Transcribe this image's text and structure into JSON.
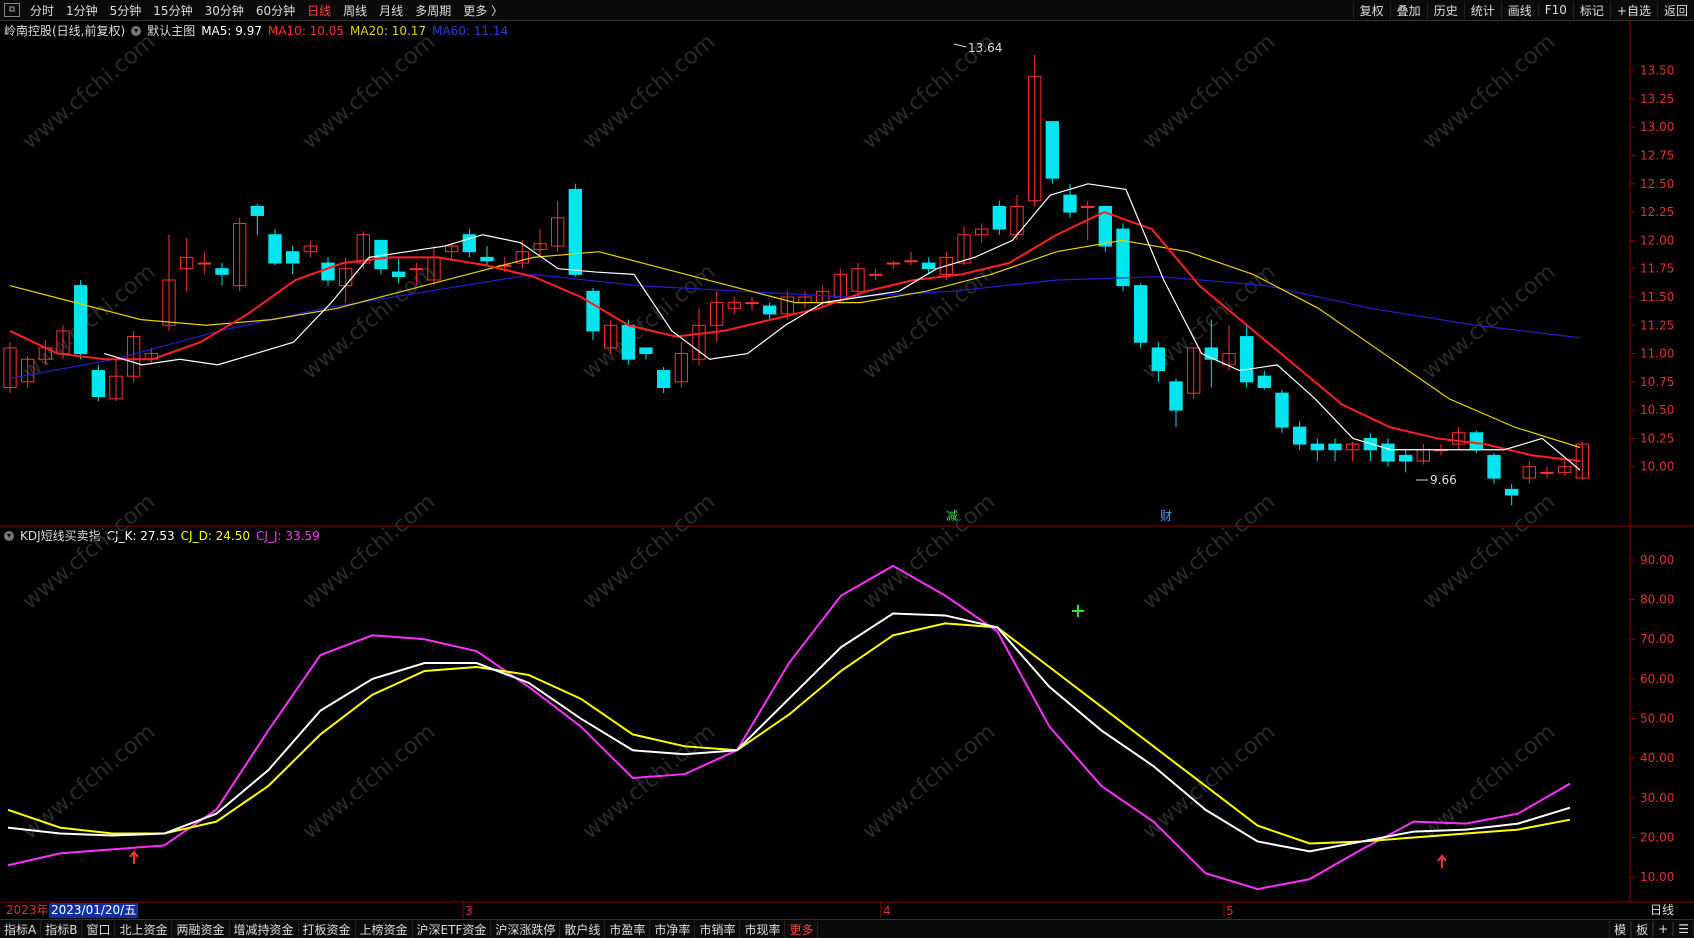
{
  "toolbar": {
    "periods": [
      "分时",
      "1分钟",
      "5分钟",
      "15分钟",
      "30分钟",
      "60分钟",
      "日线",
      "周线",
      "月线",
      "多周期",
      "更多 〉"
    ],
    "active_period": "日线",
    "right": [
      "复权",
      "叠加",
      "历史",
      "统计",
      "画线",
      "F10",
      "标记",
      "+自选",
      "返回"
    ]
  },
  "main": {
    "stock_title": "岭南控股(日线,前复权)",
    "template": "默认主图",
    "ma5": "MA5: 9.97",
    "ma10": "MA10: 10.05",
    "ma20": "MA20: 10.17",
    "ma60": "MA60: 11.14",
    "high_label": "13.64",
    "low_label": "9.66",
    "markers": [
      "减",
      "财"
    ],
    "y_ticks": [
      "13.50",
      "13.25",
      "13.00",
      "12.75",
      "12.50",
      "12.25",
      "12.00",
      "11.75",
      "11.50",
      "11.25",
      "11.00",
      "10.75",
      "10.50",
      "10.25",
      "10.00"
    ]
  },
  "kdj": {
    "name": "KDJ短线买卖指",
    "k": "CJ_K: 27.53",
    "d": "CJ_D: 24.50",
    "j": "CJ_J: 33.59",
    "y_ticks": [
      "90.00",
      "80.00",
      "70.00",
      "60.00",
      "50.00",
      "40.00",
      "30.00",
      "20.00",
      "10.00"
    ]
  },
  "timeline": {
    "year": "2023年",
    "cursor_date": "2023/01/20/五",
    "months": [
      "3",
      "4",
      "5"
    ],
    "period": "日线"
  },
  "bottom_tabs": [
    "指标A",
    "指标B",
    "窗口",
    "北上资金",
    "两融资金",
    "增减持资金",
    "打板资金",
    "上榜资金",
    "沪深ETF资金",
    "沪深涨跌停",
    "散户线",
    "市盈率",
    "市净率",
    "市销率",
    "市现率",
    "更多"
  ],
  "bottom_right": [
    "模",
    "板",
    "+",
    "☰"
  ],
  "watermark": "www.cfchi.com",
  "colors": {
    "up": "#ff3030",
    "down": "#00e5ee",
    "ma5": "#ffffff",
    "ma10": "#ff2020",
    "ma20": "#e8d000",
    "ma60": "#2020d0",
    "k": "#ffffff",
    "d": "#ffff00",
    "j": "#ff30ff",
    "grid": "#8b0000"
  },
  "chart_data": [
    {
      "type": "candlestick",
      "title": "岭南控股(日线,前复权)",
      "ylim": [
        9.6,
        13.7
      ],
      "candles": [
        [
          10.7,
          11.05,
          11.1,
          10.65
        ],
        [
          10.75,
          10.95,
          10.98,
          10.7
        ],
        [
          10.95,
          11.05,
          11.12,
          10.9
        ],
        [
          11.0,
          11.2,
          11.25,
          10.95
        ],
        [
          11.6,
          11.0,
          11.65,
          10.95
        ],
        [
          10.85,
          10.62,
          10.9,
          10.58
        ],
        [
          10.6,
          10.8,
          10.95,
          10.58
        ],
        [
          10.8,
          11.15,
          11.2,
          10.75
        ],
        [
          10.95,
          11.0,
          11.05,
          10.9
        ],
        [
          11.25,
          11.65,
          12.05,
          11.2
        ],
        [
          11.75,
          11.85,
          12.02,
          11.55
        ],
        [
          11.8,
          11.8,
          11.9,
          11.7
        ],
        [
          11.75,
          11.7,
          11.8,
          11.6
        ],
        [
          11.6,
          12.15,
          12.2,
          11.55
        ],
        [
          12.3,
          12.22,
          12.32,
          12.05
        ],
        [
          12.05,
          11.8,
          12.1,
          11.78
        ],
        [
          11.9,
          11.8,
          11.95,
          11.7
        ],
        [
          11.9,
          11.95,
          12.0,
          11.85
        ],
        [
          11.8,
          11.65,
          11.85,
          11.6
        ],
        [
          11.6,
          11.75,
          11.85,
          11.45
        ],
        [
          11.8,
          12.05,
          12.08,
          11.75
        ],
        [
          12.0,
          11.75,
          12.0,
          11.7
        ],
        [
          11.72,
          11.68,
          11.85,
          11.62
        ],
        [
          11.75,
          11.75,
          11.8,
          11.6
        ],
        [
          11.65,
          11.85,
          11.95,
          11.6
        ],
        [
          11.9,
          11.95,
          11.98,
          11.82
        ],
        [
          12.05,
          11.9,
          12.1,
          11.85
        ],
        [
          11.85,
          11.82,
          11.95,
          11.78
        ],
        [
          11.78,
          11.78,
          11.85,
          11.72
        ],
        [
          11.8,
          11.9,
          12.0,
          11.75
        ],
        [
          11.92,
          11.97,
          12.1,
          11.85
        ],
        [
          11.95,
          12.2,
          12.35,
          11.9
        ],
        [
          12.45,
          11.7,
          12.5,
          11.68
        ],
        [
          11.55,
          11.2,
          11.58,
          11.12
        ],
        [
          11.05,
          11.25,
          11.3,
          11.0
        ],
        [
          11.25,
          10.95,
          11.3,
          10.9
        ],
        [
          11.05,
          11.0,
          11.05,
          10.95
        ],
        [
          10.85,
          10.7,
          10.88,
          10.65
        ],
        [
          10.75,
          11.0,
          11.1,
          10.7
        ],
        [
          10.95,
          11.25,
          11.4,
          10.9
        ],
        [
          11.25,
          11.45,
          11.55,
          11.1
        ],
        [
          11.4,
          11.45,
          11.5,
          11.35
        ],
        [
          11.45,
          11.45,
          11.5,
          11.38
        ],
        [
          11.42,
          11.35,
          11.45,
          11.3
        ],
        [
          11.35,
          11.5,
          11.55,
          11.3
        ],
        [
          11.45,
          11.5,
          11.55,
          11.4
        ],
        [
          11.45,
          11.55,
          11.6,
          11.4
        ],
        [
          11.5,
          11.7,
          11.75,
          11.45
        ],
        [
          11.55,
          11.75,
          11.8,
          11.5
        ],
        [
          11.7,
          11.7,
          11.75,
          11.65
        ],
        [
          11.8,
          11.8,
          11.82,
          11.75
        ],
        [
          11.82,
          11.82,
          11.9,
          11.78
        ],
        [
          11.8,
          11.75,
          11.85,
          11.7
        ],
        [
          11.7,
          11.85,
          11.9,
          11.65
        ],
        [
          11.8,
          12.05,
          12.12,
          11.78
        ],
        [
          12.05,
          12.1,
          12.15,
          11.98
        ],
        [
          12.3,
          12.1,
          12.35,
          12.05
        ],
        [
          12.05,
          12.3,
          12.4,
          12.0
        ],
        [
          12.35,
          13.45,
          13.64,
          12.3
        ],
        [
          13.05,
          12.55,
          13.05,
          12.5
        ],
        [
          12.4,
          12.25,
          12.5,
          12.2
        ],
        [
          12.3,
          12.3,
          12.35,
          12.0
        ],
        [
          12.3,
          11.95,
          12.3,
          11.9
        ],
        [
          12.1,
          11.6,
          12.15,
          11.55
        ],
        [
          11.6,
          11.1,
          11.62,
          11.05
        ],
        [
          11.05,
          10.85,
          11.1,
          10.75
        ],
        [
          10.75,
          10.5,
          10.78,
          10.35
        ],
        [
          10.65,
          11.05,
          11.05,
          10.6
        ],
        [
          11.05,
          10.95,
          11.3,
          10.7
        ],
        [
          10.9,
          11.0,
          11.25,
          10.85
        ],
        [
          11.15,
          10.75,
          11.25,
          10.7
        ],
        [
          10.8,
          10.7,
          10.85,
          10.68
        ],
        [
          10.65,
          10.35,
          10.68,
          10.3
        ],
        [
          10.35,
          10.2,
          10.4,
          10.15
        ],
        [
          10.2,
          10.15,
          10.25,
          10.05
        ],
        [
          10.2,
          10.15,
          10.25,
          10.05
        ],
        [
          10.15,
          10.2,
          10.22,
          10.05
        ],
        [
          10.25,
          10.15,
          10.3,
          10.05
        ],
        [
          10.2,
          10.05,
          10.25,
          10.0
        ],
        [
          10.1,
          10.05,
          10.15,
          9.95
        ],
        [
          10.05,
          10.15,
          10.2,
          10.02
        ],
        [
          10.15,
          10.15,
          10.2,
          10.1
        ],
        [
          10.2,
          10.3,
          10.35,
          10.15
        ],
        [
          10.3,
          10.15,
          10.32,
          10.12
        ],
        [
          10.1,
          9.9,
          10.12,
          9.85
        ],
        [
          9.8,
          9.75,
          9.85,
          9.66
        ],
        [
          9.9,
          10.0,
          10.05,
          9.85
        ],
        [
          9.95,
          9.95,
          10.0,
          9.9
        ],
        [
          9.95,
          10.0,
          10.05,
          9.92
        ],
        [
          9.9,
          10.2,
          10.22,
          9.88
        ]
      ],
      "ma5_values": [
        11.0,
        10.9,
        10.95,
        10.9,
        11.0,
        11.1,
        11.45,
        11.85,
        11.9,
        11.95,
        12.05,
        11.98,
        11.75,
        11.72,
        11.7,
        11.2,
        10.95,
        11.0,
        11.25,
        11.45,
        11.5,
        11.55,
        11.75,
        11.85,
        12.0,
        12.4,
        12.5,
        12.45,
        11.65,
        11.0,
        10.85,
        10.9,
        10.6,
        10.25,
        10.15,
        10.15,
        10.15,
        10.15,
        10.25,
        9.97
      ],
      "ma10_values": [
        11.2,
        11.0,
        10.95,
        10.95,
        11.1,
        11.35,
        11.65,
        11.8,
        11.85,
        11.85,
        11.78,
        11.68,
        11.5,
        11.25,
        11.15,
        11.2,
        11.3,
        11.4,
        11.55,
        11.65,
        11.7,
        11.8,
        12.05,
        12.25,
        12.1,
        11.6,
        11.25,
        10.9,
        10.55,
        10.35,
        10.25,
        10.2,
        10.1,
        10.05
      ],
      "ma20_values": [
        11.6,
        11.45,
        11.3,
        11.25,
        11.3,
        11.4,
        11.55,
        11.7,
        11.85,
        11.9,
        11.75,
        11.6,
        11.45,
        11.45,
        11.55,
        11.7,
        11.9,
        12.0,
        11.9,
        11.7,
        11.4,
        11.0,
        10.6,
        10.35,
        10.17
      ],
      "ma60_values": [
        10.78,
        10.95,
        11.2,
        11.4,
        11.55,
        11.7,
        11.6,
        11.55,
        11.5,
        11.55,
        11.65,
        11.68,
        11.6,
        11.4,
        11.25,
        11.14
      ],
      "high": 13.64,
      "low": 9.66
    },
    {
      "type": "line",
      "title": "KDJ短线买卖指",
      "ylim": [
        5,
        92
      ],
      "series": [
        {
          "name": "CJ_K",
          "values": [
            22.5,
            21,
            20.5,
            21,
            26,
            37,
            52,
            60,
            64,
            64,
            59,
            50,
            42,
            41,
            42,
            55,
            68,
            76.5,
            76,
            73,
            58,
            47,
            38,
            27,
            19,
            16.5,
            19,
            21.5,
            22,
            23.5,
            27.53
          ]
        },
        {
          "name": "CJ_D",
          "values": [
            27,
            22.5,
            21,
            21,
            24,
            33,
            46,
            56,
            62,
            63,
            61,
            55,
            46,
            43,
            42,
            51,
            62,
            71,
            74,
            73,
            63,
            53,
            43,
            33,
            23,
            18.5,
            19,
            20,
            21,
            22,
            24.5
          ]
        },
        {
          "name": "CJ_J",
          "values": [
            13,
            16,
            17,
            18,
            27,
            47,
            66,
            71,
            70,
            67,
            58,
            48,
            35,
            36,
            42,
            64,
            81,
            88.5,
            81,
            72,
            48,
            33,
            24,
            11,
            7,
            9.5,
            17,
            24,
            23.5,
            26,
            33.59
          ]
        }
      ]
    }
  ]
}
